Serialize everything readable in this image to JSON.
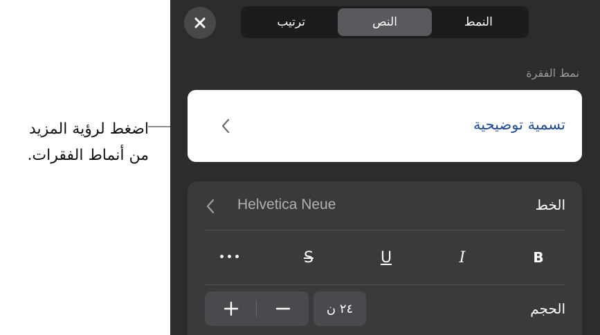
{
  "callout": {
    "line1": "اضغط لرؤية المزيد",
    "line2": "من أنماط الفقرات."
  },
  "tabs": [
    {
      "label": "النمط",
      "active": false
    },
    {
      "label": "النص",
      "active": true
    },
    {
      "label": "ترتيب",
      "active": false
    }
  ],
  "paragraph_style": {
    "section_label": "نمط الفقرة",
    "current": "تسمية توضيحية"
  },
  "font": {
    "label": "الخط",
    "name": "Helvetica Neue"
  },
  "styles": {
    "bold": "B",
    "italic": "I",
    "underline": "U",
    "strikethrough": "S",
    "more": "•••"
  },
  "size": {
    "label": "الحجم",
    "value": "٢٤ ن"
  },
  "colors": {
    "panel_bg": "#2c2c2e",
    "card_bg": "#3a3a3c",
    "accent_text": "#1c4a94"
  },
  "icons": {
    "close": "x-icon",
    "chevron": "chevron-left-icon",
    "plus": "plus-icon",
    "minus": "minus-icon"
  }
}
